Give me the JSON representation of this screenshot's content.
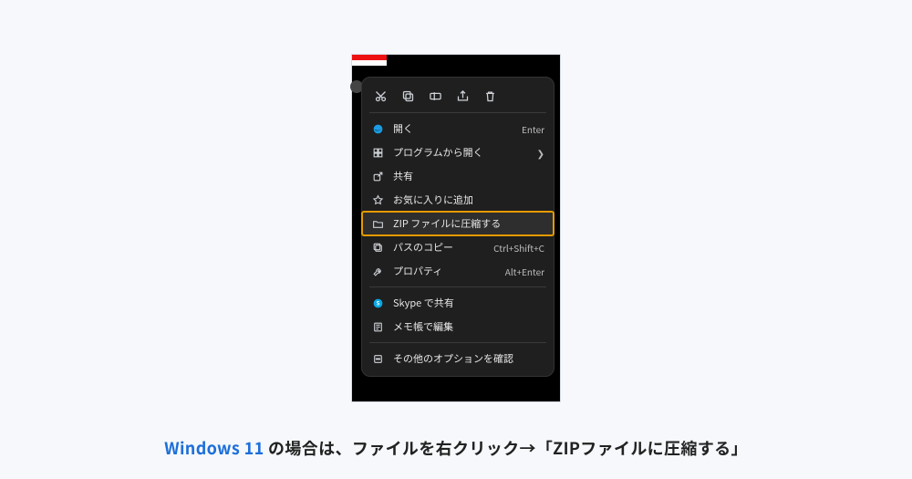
{
  "toolbar_icons": [
    "cut-icon",
    "copy-icon",
    "rename-icon",
    "share-icon",
    "delete-icon"
  ],
  "menu": {
    "open": {
      "label": "開く",
      "hint": "Enter"
    },
    "open_with": {
      "label": "プログラムから開く"
    },
    "share": {
      "label": "共有"
    },
    "favorite": {
      "label": "お気に入りに追加"
    },
    "zip": {
      "label": "ZIP ファイルに圧縮する"
    },
    "copy_path": {
      "label": "パスのコピー",
      "hint": "Ctrl+Shift+C"
    },
    "properties": {
      "label": "プロパティ",
      "hint": "Alt+Enter"
    },
    "skype": {
      "label": "Skype で共有"
    },
    "notepad": {
      "label": "メモ帳で編集"
    },
    "more": {
      "label": "その他のオプションを確認"
    }
  },
  "caption": {
    "accent": "Windows 11",
    "rest": " の場合は、ファイルを右クリック→「ZIPファイルに圧縮する」"
  }
}
